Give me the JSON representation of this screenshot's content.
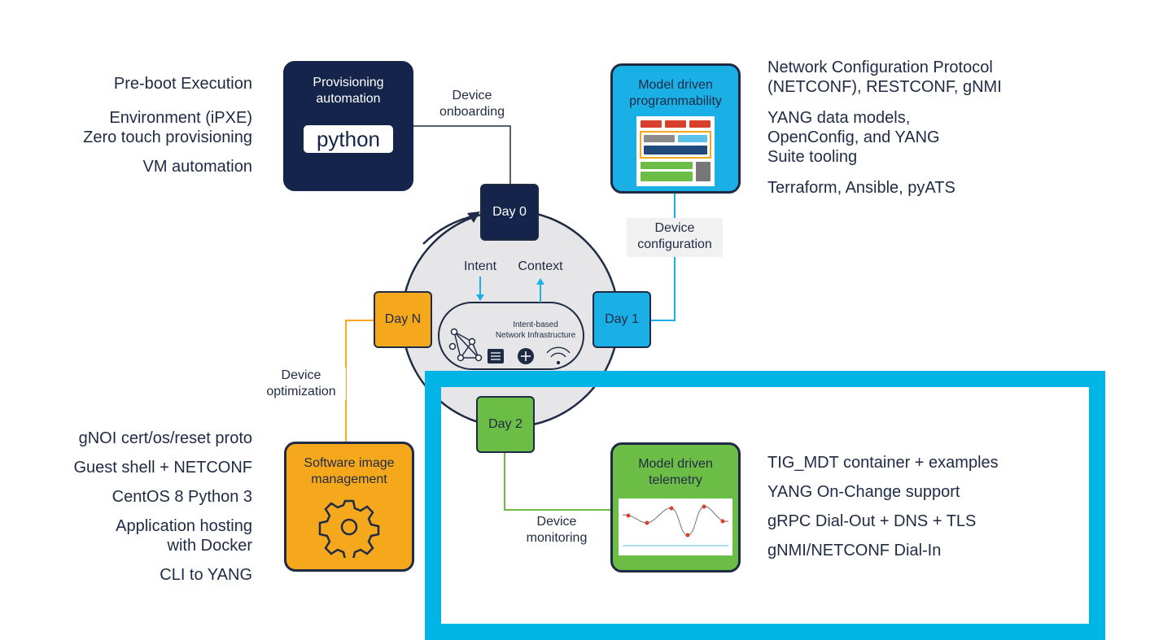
{
  "colors": {
    "navy": "#14244a",
    "blue": "#1ab0e6",
    "orange": "#f5a81c",
    "green": "#6cbd45",
    "highlight": "#00b5e5"
  },
  "left_top_items": [
    "Pre-boot Execution",
    "Environment (iPXE)\nZero touch provisioning",
    "VM automation"
  ],
  "right_top_items": [
    "Network Configuration Protocol\n(NETCONF), RESTCONF, gNMI",
    "YANG data models,\nOpenConfig, and YANG\nSuite tooling",
    "Terraform, Ansible, pyATS"
  ],
  "left_bottom_items": [
    "gNOI cert/os/reset proto",
    "Guest shell + NETCONF",
    "CentOS 8 Python 3",
    "Application hosting\nwith Docker",
    "CLI to YANG"
  ],
  "right_bottom_items": [
    "TIG_MDT container + examples",
    "YANG On-Change support",
    "gRPC Dial-Out + DNS + TLS",
    "gNMI/NETCONF Dial-In"
  ],
  "cards": {
    "provisioning": {
      "title": "Provisioning\nautomation",
      "badge": "python"
    },
    "programmability": {
      "title": "Model driven\nprogrammability"
    },
    "software": {
      "title": "Software image\nmanagement",
      "icon": "gear-icon"
    },
    "telemetry": {
      "title": "Model driven\ntelemetry"
    }
  },
  "days": {
    "day0": "Day 0",
    "day1": "Day 1",
    "day2": "Day 2",
    "dayn": "Day N"
  },
  "edges": {
    "onboarding": "Device\nonboarding",
    "configuration": "Device\nconfiguration",
    "optimization": "Device\noptimization",
    "monitoring": "Device\nmonitoring"
  },
  "center": {
    "intent": "Intent",
    "context": "Context",
    "infra": "Intent-based\nNetwork Infrastructure"
  }
}
